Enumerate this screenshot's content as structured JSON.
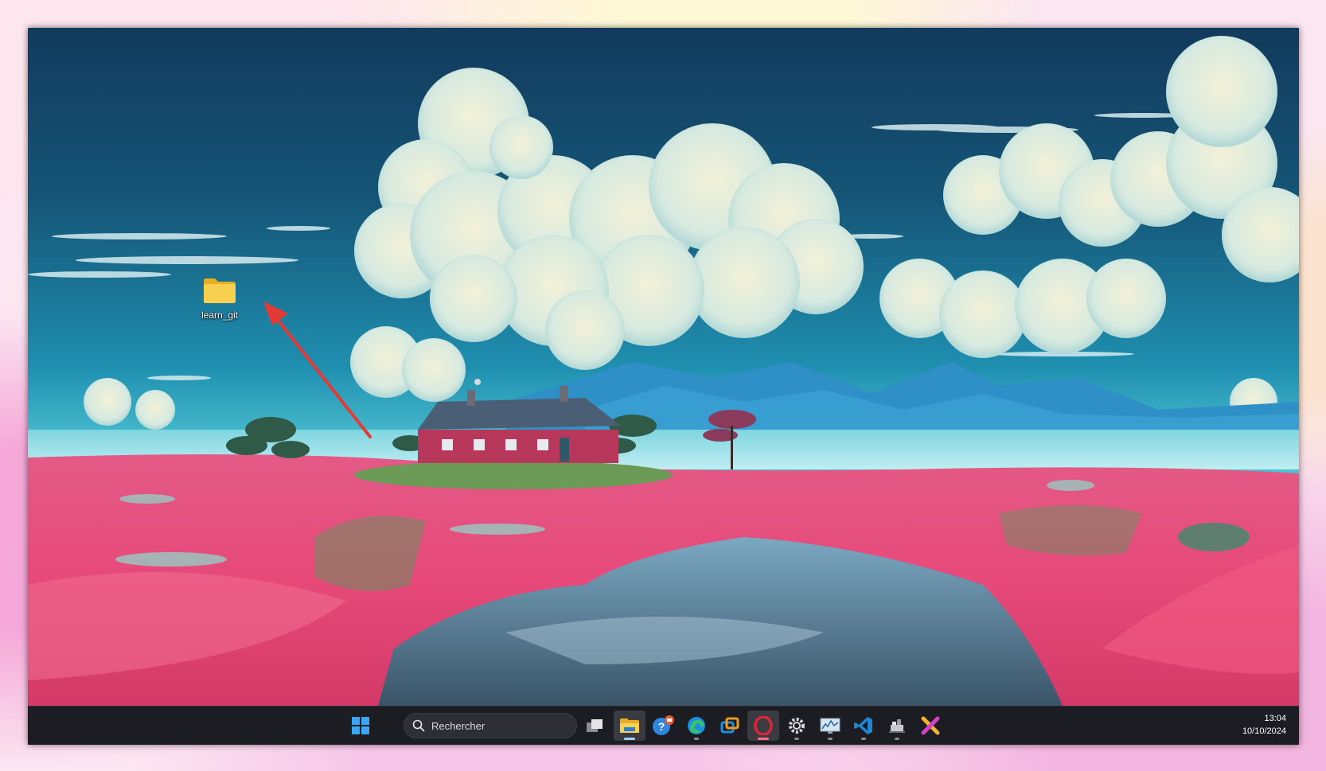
{
  "desktop": {
    "icons": [
      {
        "label": "learn_git",
        "icon": "folder-icon"
      }
    ]
  },
  "taskbar": {
    "search": {
      "placeholder": "Rechercher",
      "icon": "search-icon"
    },
    "apps": [
      {
        "name": "start-button",
        "icon": "windows-logo-icon"
      },
      {
        "name": "task-view",
        "icon": "task-view-icon"
      },
      {
        "name": "file-explorer",
        "icon": "folder-icon",
        "active": true
      },
      {
        "name": "get-help",
        "icon": "help-icon"
      },
      {
        "name": "edge",
        "icon": "edge-icon"
      },
      {
        "name": "remote-desktop",
        "icon": "remote-desktop-icon"
      },
      {
        "name": "opera",
        "icon": "opera-icon"
      },
      {
        "name": "settings",
        "icon": "gear-icon"
      },
      {
        "name": "resource-monitor",
        "icon": "monitor-chart-icon"
      },
      {
        "name": "vscode",
        "icon": "vscode-icon"
      },
      {
        "name": "docker",
        "icon": "docker-icon"
      },
      {
        "name": "xmind",
        "icon": "xmind-icon"
      }
    ],
    "clock": {
      "time": "13:04",
      "date": "10/10/2024"
    }
  },
  "colors": {
    "taskbar_bg": "#1c1d22",
    "annotation_arrow": "#e53935",
    "folder_yellow": "#f4c542"
  }
}
